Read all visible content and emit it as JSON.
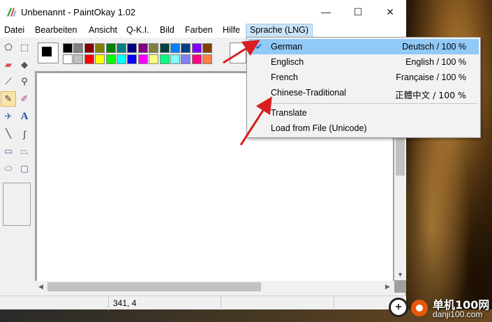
{
  "window": {
    "title": "Unbenannt - PaintOkay 1.02",
    "minimize_glyph": "—",
    "maximize_glyph": "☐",
    "close_glyph": "✕"
  },
  "menubar": {
    "items": [
      {
        "label": "Datei"
      },
      {
        "label": "Bearbeiten"
      },
      {
        "label": "Ansicht"
      },
      {
        "label": "Q-K.I."
      },
      {
        "label": "Bild"
      },
      {
        "label": "Farben"
      },
      {
        "label": "Hilfe"
      },
      {
        "label": "Sprache (LNG)"
      }
    ]
  },
  "tools": [
    {
      "icon": "free-select-icon",
      "glyph": "⬠"
    },
    {
      "icon": "rect-select-icon",
      "glyph": "⬚"
    },
    {
      "icon": "eraser-icon",
      "glyph": "▰"
    },
    {
      "icon": "fill-bucket-icon",
      "glyph": "◆"
    },
    {
      "icon": "color-picker-icon",
      "glyph": "⟋"
    },
    {
      "icon": "magnifier-icon",
      "glyph": "⚲"
    },
    {
      "icon": "pencil-icon",
      "glyph": "✎"
    },
    {
      "icon": "brush-icon",
      "glyph": "✐"
    },
    {
      "icon": "airbrush-icon",
      "glyph": "✈"
    },
    {
      "icon": "text-icon",
      "glyph": "A"
    },
    {
      "icon": "line-icon",
      "glyph": "╲"
    },
    {
      "icon": "curve-icon",
      "glyph": "∫"
    },
    {
      "icon": "rectangle-icon",
      "glyph": "▭"
    },
    {
      "icon": "polygon-icon",
      "glyph": "⏢"
    },
    {
      "icon": "ellipse-icon",
      "glyph": "⬭"
    },
    {
      "icon": "rounded-rect-icon",
      "glyph": "▢"
    }
  ],
  "palette": {
    "foreground": "#000000",
    "background": "#ffffff",
    "top_row": [
      "#000000",
      "#808080",
      "#800000",
      "#808000",
      "#008000",
      "#008080",
      "#000080",
      "#800080",
      "#808040",
      "#004040",
      "#0080ff",
      "#004080",
      "#8000ff",
      "#804000"
    ],
    "bottom_row": [
      "#ffffff",
      "#c0c0c0",
      "#ff0000",
      "#ffff00",
      "#00ff00",
      "#00ffff",
      "#0000ff",
      "#ff00ff",
      "#ffff80",
      "#00ff80",
      "#80ffff",
      "#8080ff",
      "#ff0080",
      "#ff8040"
    ]
  },
  "statusbar": {
    "coords": "341, 4"
  },
  "language_menu": {
    "items": [
      {
        "label": "German",
        "right": "Deutsch / 100 %",
        "checked": true,
        "highlight": true
      },
      {
        "label": "Englisch",
        "right": "English / 100 %"
      },
      {
        "label": "French",
        "right": "Française / 100 %"
      },
      {
        "label": "Chinese-Traditional",
        "right": "正體中文 / 100 %"
      }
    ],
    "actions": [
      {
        "label": "Translate"
      },
      {
        "label": "Load from File (Unicode)"
      }
    ],
    "check_glyph": "✔"
  },
  "colors": {
    "menu_highlight": "#91c9f7",
    "active_menu": "#cce4f7",
    "arrow": "#d91f1f"
  },
  "watermark": {
    "logo_glyph": "+",
    "text_cn": "单机100网",
    "url": "danji100.com"
  }
}
